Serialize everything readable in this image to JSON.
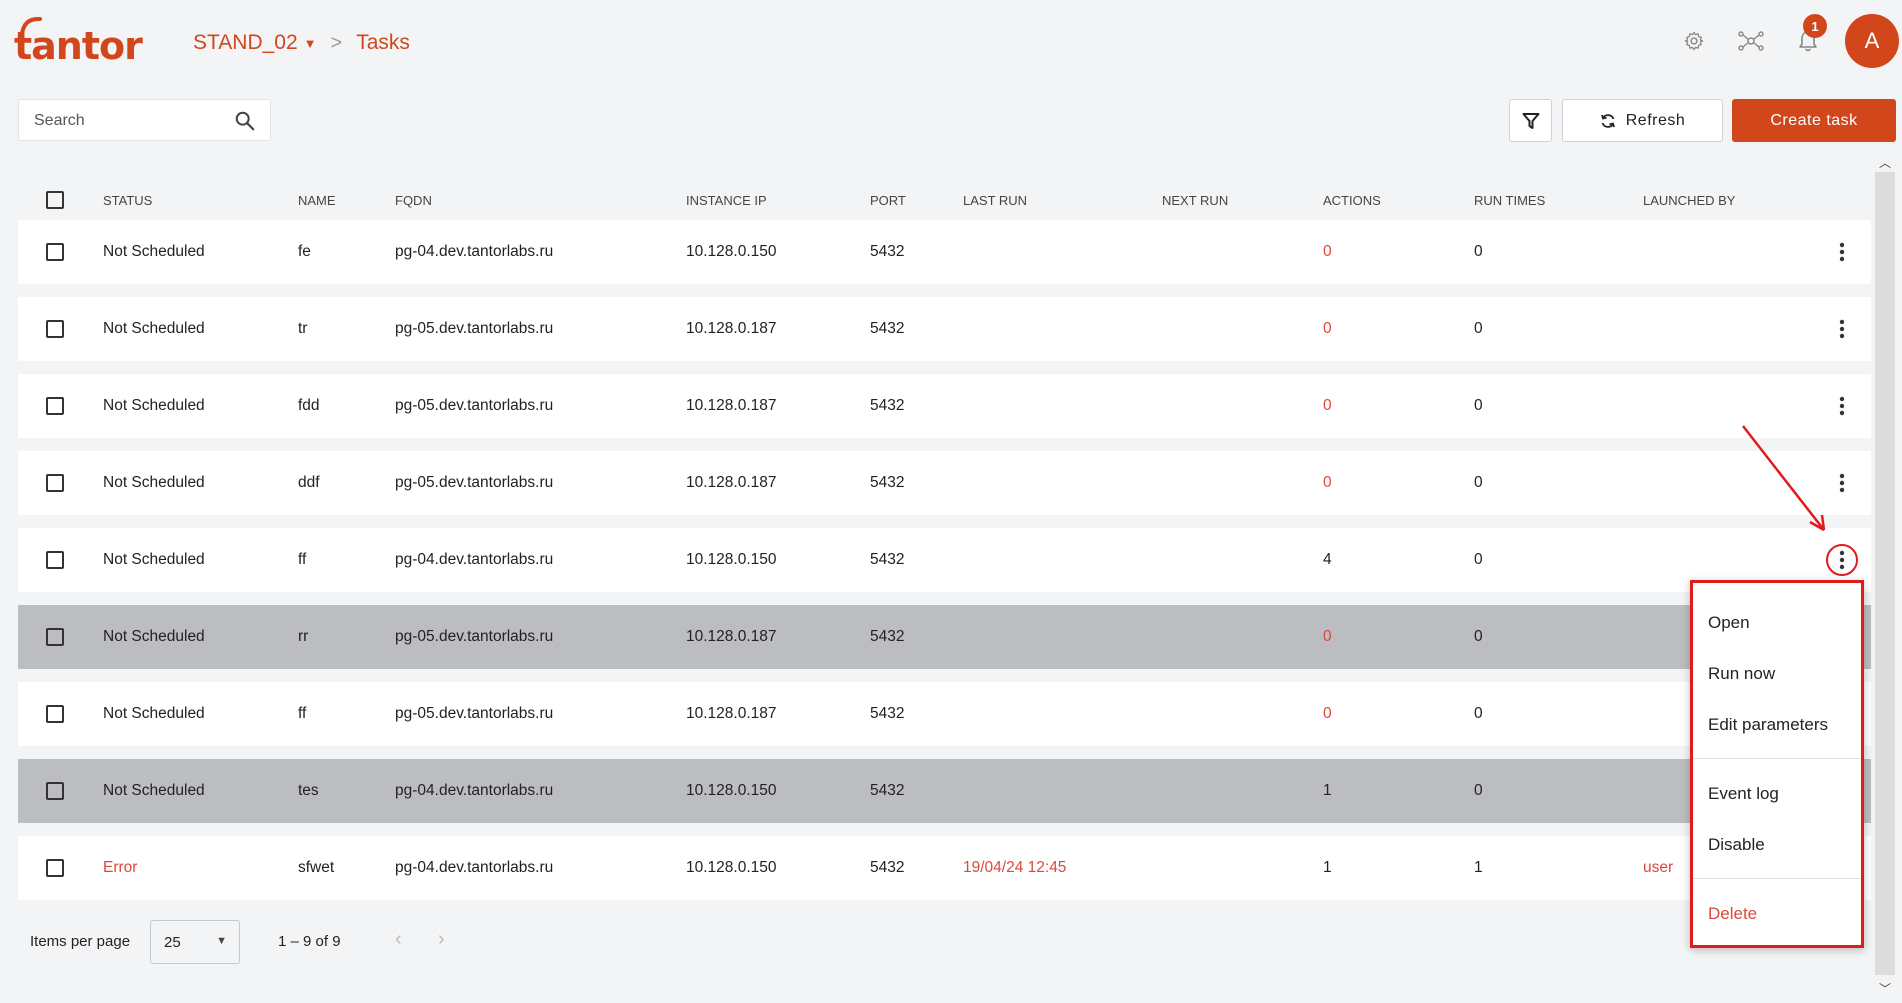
{
  "brand": {
    "logo_text": "tantor",
    "accent": "#d2461b"
  },
  "breadcrumb": {
    "stand": "STAND_02",
    "separator": ">",
    "page": "Tasks"
  },
  "header": {
    "icons": [
      "gear-icon",
      "network-icon",
      "bell-icon"
    ],
    "notification_count": "1",
    "avatar_initial": "A"
  },
  "toolbar": {
    "search_placeholder": "Search",
    "refresh_label": "Refresh",
    "create_label": "Create task"
  },
  "table": {
    "columns": [
      "Status",
      "Name",
      "FQDN",
      "Instance IP",
      "Port",
      "Last run",
      "Next run",
      "Actions",
      "Run times",
      "Launched by"
    ],
    "rows": [
      {
        "status": "Not Scheduled",
        "name": "fe",
        "fqdn": "pg-04.dev.tantorlabs.ru",
        "ip": "10.128.0.150",
        "port": "5432",
        "last_run": "",
        "next_run": "",
        "actions": "0",
        "run_times": "0",
        "launched_by": ""
      },
      {
        "status": "Not Scheduled",
        "name": "tr",
        "fqdn": "pg-05.dev.tantorlabs.ru",
        "ip": "10.128.0.187",
        "port": "5432",
        "last_run": "",
        "next_run": "",
        "actions": "0",
        "run_times": "0",
        "launched_by": ""
      },
      {
        "status": "Not Scheduled",
        "name": "fdd",
        "fqdn": "pg-05.dev.tantorlabs.ru",
        "ip": "10.128.0.187",
        "port": "5432",
        "last_run": "",
        "next_run": "",
        "actions": "0",
        "run_times": "0",
        "launched_by": ""
      },
      {
        "status": "Not Scheduled",
        "name": "ddf",
        "fqdn": "pg-05.dev.tantorlabs.ru",
        "ip": "10.128.0.187",
        "port": "5432",
        "last_run": "",
        "next_run": "",
        "actions": "0",
        "run_times": "0",
        "launched_by": ""
      },
      {
        "status": "Not Scheduled",
        "name": "ff",
        "fqdn": "pg-04.dev.tantorlabs.ru",
        "ip": "10.128.0.150",
        "port": "5432",
        "last_run": "",
        "next_run": "",
        "actions": "4",
        "run_times": "0",
        "launched_by": ""
      },
      {
        "status": "Not Scheduled",
        "name": "rr",
        "fqdn": "pg-05.dev.tantorlabs.ru",
        "ip": "10.128.0.187",
        "port": "5432",
        "last_run": "",
        "next_run": "",
        "actions": "0",
        "run_times": "0",
        "launched_by": ""
      },
      {
        "status": "Not Scheduled",
        "name": "ff",
        "fqdn": "pg-05.dev.tantorlabs.ru",
        "ip": "10.128.0.187",
        "port": "5432",
        "last_run": "",
        "next_run": "",
        "actions": "0",
        "run_times": "0",
        "launched_by": ""
      },
      {
        "status": "Not Scheduled",
        "name": "tes",
        "fqdn": "pg-04.dev.tantorlabs.ru",
        "ip": "10.128.0.150",
        "port": "5432",
        "last_run": "",
        "next_run": "",
        "actions": "1",
        "run_times": "0",
        "launched_by": ""
      },
      {
        "status": "Error",
        "name": "sfwet",
        "fqdn": "pg-04.dev.tantorlabs.ru",
        "ip": "10.128.0.150",
        "port": "5432",
        "last_run": "19/04/24 12:45",
        "next_run": "",
        "actions": "1",
        "run_times": "1",
        "launched_by": "user"
      }
    ],
    "highlighted_rows": [
      5,
      7
    ],
    "open_menu_row": 4
  },
  "pagination": {
    "items_per_page_label": "Items per page",
    "items_per_page": "25",
    "range": "1 – 9 of 9"
  },
  "context_menu": {
    "items": [
      "Open",
      "Run now",
      "Edit parameters",
      "Event log",
      "Disable",
      "Delete"
    ]
  }
}
